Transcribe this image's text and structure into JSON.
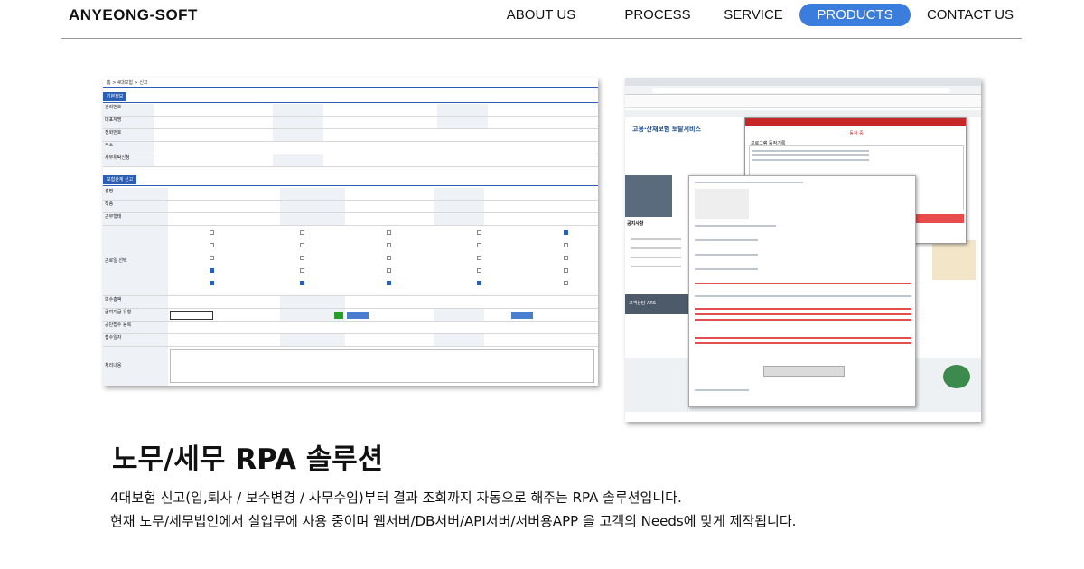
{
  "header": {
    "logo": "ANYEONG-SOFT",
    "nav": [
      {
        "label": "ABOUT US",
        "active": false
      },
      {
        "label": "PROCESS",
        "active": false
      },
      {
        "label": "SERVICE",
        "active": false
      },
      {
        "label": "PRODUCTS",
        "active": true
      },
      {
        "label": "CONTACT US",
        "active": false
      }
    ],
    "accent_color": "#3b7ddd"
  },
  "main": {
    "title": "노무/세무 RPA 솔루션",
    "description_line1": "4대보험 신고(입,퇴사 / 보수변경 / 사무수임)부터 결과 조회까지 자동으로 해주는 RPA 솔루션입니다.",
    "description_line2": "현재 노무/세무법인에서 실업무에 사용 중이며 웹서버/DB서버/API서버/서버용APP 을 고객의 Needs에 맞게 제작됩니다."
  },
  "screenshots": {
    "left": {
      "breadcrumb": "홈 > 4대보험 > 신고",
      "section1": "기본정보",
      "section2": "보험관계 신고",
      "labels": [
        "관리번호",
        "대표자명",
        "전화번호",
        "주소",
        "사무위탁신청",
        "성명",
        "직종",
        "근무형태",
        "근로일 선택",
        "보수총액",
        "급여지급 유형",
        "공단접수 등록",
        "접수일자",
        "처리내용"
      ]
    },
    "right": {
      "site_title": "고용·산재보험 토탈서비스",
      "popup_title": "동작 중",
      "popup_log_title": "프로그램 동작기록",
      "notice_label": "공지사항",
      "consult_label": "고객상담 ARS"
    }
  }
}
